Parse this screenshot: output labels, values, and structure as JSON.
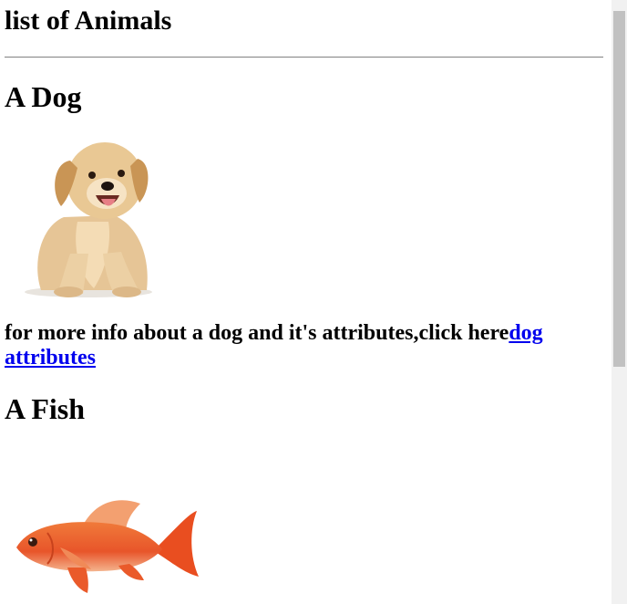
{
  "page": {
    "title": "list of Animals"
  },
  "sections": {
    "dog": {
      "heading": "A Dog",
      "image_alt": "dog",
      "info_text": "for more info about a dog and it's attributes,click here",
      "link_text": "dog attributes"
    },
    "fish": {
      "heading": "A Fish",
      "image_alt": "fish"
    }
  },
  "colors": {
    "link": "#0000ee",
    "scrollbar_track": "#f1f1f1",
    "scrollbar_thumb": "#c1c1c1"
  }
}
